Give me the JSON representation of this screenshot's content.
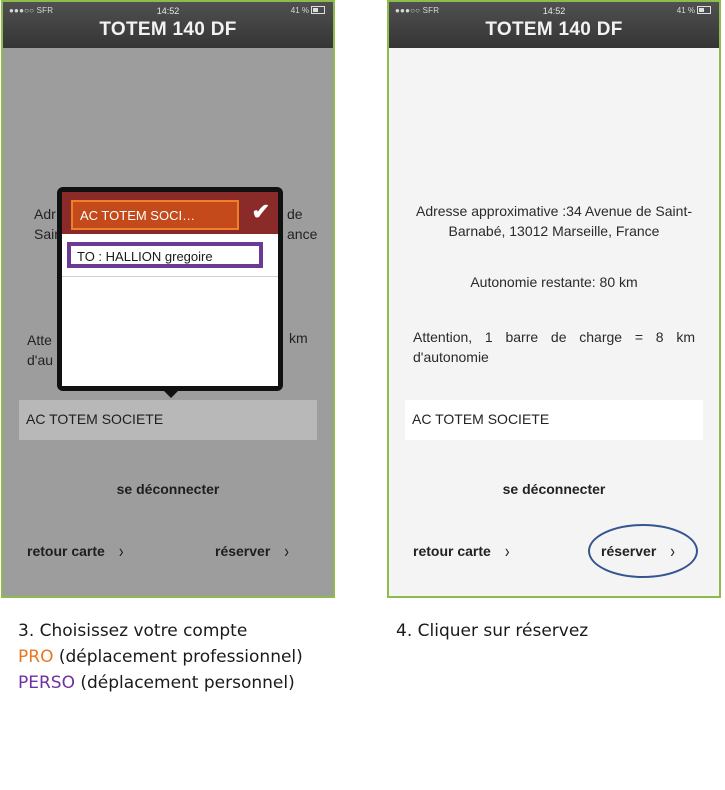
{
  "left_screen": {
    "carrier": "●●●○○ SFR",
    "time": "14:52",
    "battery": "41 %",
    "title": "TOTEM 140 DF",
    "address_left": "Adr",
    "address_left2": "Sain",
    "address_right": "de",
    "address_right2": "ance",
    "warning_left": "Atte",
    "warning_left2": "d'au",
    "warning_right": "km",
    "account_value": "AC TOTEM SOCIETE",
    "logout_label": "se déconnecter",
    "back_label": "retour carte",
    "reserve_label": "réserver",
    "popover": {
      "selected_option": "AC TOTEM SOCI…",
      "options": [
        "TO : HALLION gregoire"
      ]
    }
  },
  "right_screen": {
    "carrier": "●●●○○ SFR",
    "time": "14:52",
    "battery": "41 %",
    "title": "TOTEM 140 DF",
    "address": "Adresse approximative :34 Avenue de Saint-Barnabé, 13012 Marseille, France",
    "autonomy": "Autonomie restante: 80 km",
    "warning": "Attention, 1 barre de charge = 8 km d'autonomie",
    "account_value": "AC TOTEM SOCIETE",
    "logout_label": "se déconnecter",
    "back_label": "retour carte",
    "reserve_label": "réserver"
  },
  "captions": {
    "step3_line1": "3. Choisissez votre compte",
    "step3_pro": "PRO",
    "step3_pro_rest": " (déplacement professionnel)",
    "step3_perso": "PERSO",
    "step3_perso_rest": " (déplacement personnel)",
    "step4": "4. Cliquer sur réservez"
  },
  "colors": {
    "frame_border": "#8dbb4d",
    "pro": "#e87722",
    "perso": "#7030a0",
    "highlight_ellipse": "#34558f"
  }
}
